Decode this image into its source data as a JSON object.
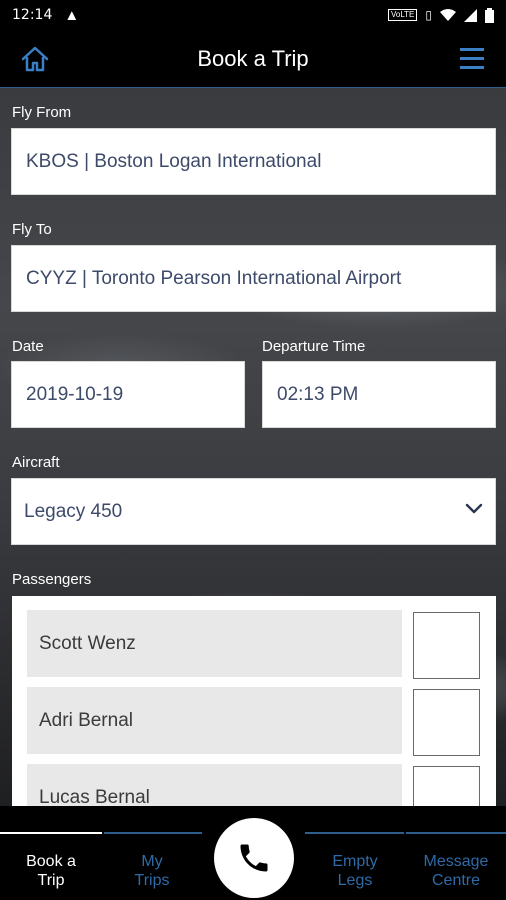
{
  "status_bar": {
    "time": "12:14",
    "network": "VoLTE"
  },
  "header": {
    "title": "Book a Trip"
  },
  "form": {
    "fly_from": {
      "label": "Fly From",
      "value": "KBOS | Boston Logan International"
    },
    "fly_to": {
      "label": "Fly To",
      "value": "CYYZ | Toronto Pearson International Airport"
    },
    "date": {
      "label": "Date",
      "value": "2019-10-19"
    },
    "departure_time": {
      "label": "Departure Time",
      "value": "02:13 PM"
    },
    "aircraft": {
      "label": "Aircraft",
      "value": "Legacy 450"
    },
    "passengers": {
      "label": "Passengers",
      "items": [
        {
          "name": "Scott Wenz",
          "checked": false
        },
        {
          "name": "Adri Bernal",
          "checked": false
        },
        {
          "name": "Lucas Bernal",
          "checked": false
        }
      ]
    }
  },
  "tabs": [
    {
      "line1": "Book a",
      "line2": "Trip",
      "active": true
    },
    {
      "line1": "My",
      "line2": "Trips",
      "active": false
    },
    {
      "line1": "Empty",
      "line2": "Legs",
      "active": false
    },
    {
      "line1": "Message",
      "line2": "Centre",
      "active": false
    }
  ],
  "colors": {
    "accent": "#2f6aa8",
    "header_bg": "#000000",
    "field_text": "#3d4a6a"
  },
  "icons": [
    "home-icon",
    "hamburger-menu-icon",
    "chevron-down-icon",
    "phone-icon",
    "warning-icon",
    "wifi-icon",
    "battery-icon"
  ]
}
